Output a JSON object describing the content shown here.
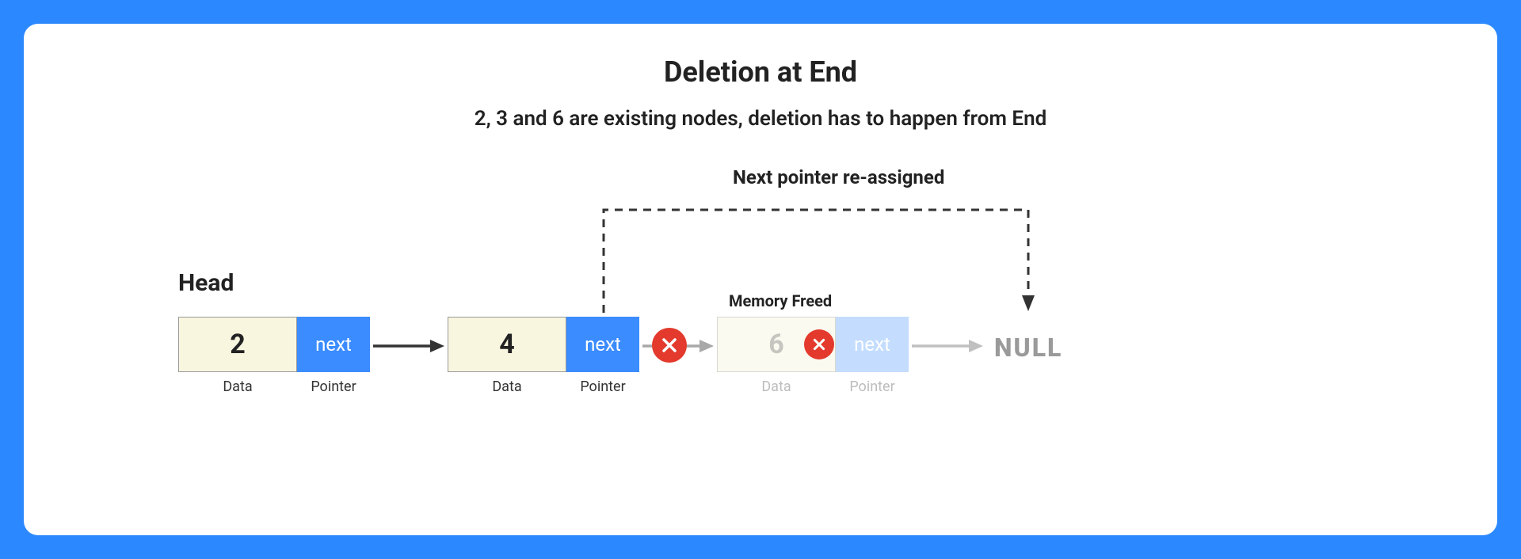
{
  "title": "Deletion at End",
  "subtitle": "2, 3 and 6 are existing nodes, deletion has to happen from End",
  "head_label": "Head",
  "reassigned_label": "Next pointer re-assigned",
  "memory_freed_label": "Memory Freed",
  "null_label": "NULL",
  "labels": {
    "data": "Data",
    "pointer": "Pointer",
    "next": "next"
  },
  "nodes": [
    {
      "value": "2",
      "faded": false
    },
    {
      "value": "4",
      "faded": false
    },
    {
      "value": "6",
      "faded": true
    }
  ],
  "colors": {
    "accent": "#2b88ff",
    "nodeData": "#f9f6df",
    "nodePointer": "#3b8cff",
    "cross": "#e33a2d",
    "nullText": "#9a9a9a"
  }
}
